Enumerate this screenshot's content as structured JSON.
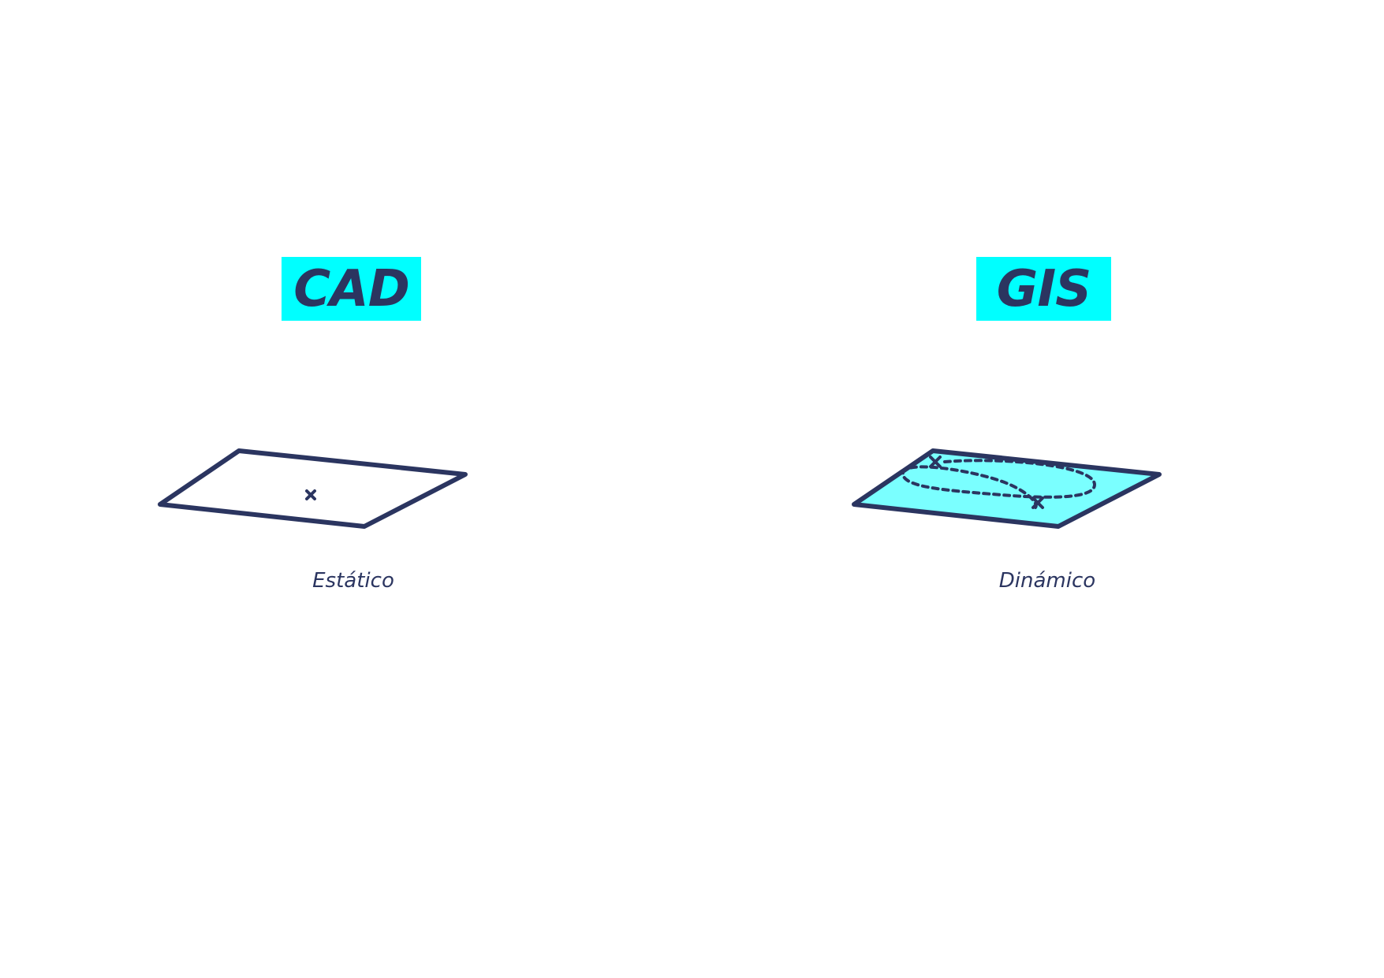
{
  "colors": {
    "ink": "#2b3560",
    "highlight": "#00ffff",
    "fill_light": "#7affff",
    "background": "#ffffff"
  },
  "cad": {
    "title": "CAD",
    "caption": "Estático",
    "plane_filled": false,
    "icons": [
      "x-mark-icon"
    ]
  },
  "gis": {
    "title": "GIS",
    "caption": "Dinámico",
    "plane_filled": true,
    "icons": [
      "x-mark-icon",
      "x-mark-icon",
      "dashed-loop-icon"
    ]
  }
}
